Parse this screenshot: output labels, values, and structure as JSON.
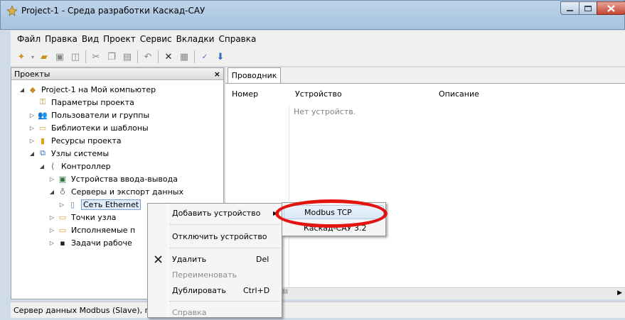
{
  "window": {
    "title": "Project-1 - Среда разработки Каскад-САУ"
  },
  "menu": [
    "Файл",
    "Правка",
    "Вид",
    "Проект",
    "Сервис",
    "Вкладки",
    "Справка"
  ],
  "projects_pane": {
    "title": "Проекты",
    "close_glyph": "×",
    "tree": [
      {
        "label": "Project-1 на Мой компьютер",
        "arrow": "◢",
        "icon": "◆",
        "color": "#c88c2a"
      },
      {
        "label": "Параметры проекта",
        "arrow": "",
        "icon": "⚿",
        "color": "#b08a1e"
      },
      {
        "label": "Пользователи и группы",
        "arrow": "▷",
        "icon": "👥",
        "color": "#4a6da0"
      },
      {
        "label": "Библиотеки и шаблоны",
        "arrow": "▷",
        "icon": "▭",
        "color": "#d9a53a"
      },
      {
        "label": "Ресурсы проекта",
        "arrow": "▷",
        "icon": "▮",
        "color": "#e0a020"
      },
      {
        "label": "Узлы системы",
        "arrow": "◢",
        "icon": "⧉",
        "color": "#3a6bbf"
      },
      {
        "label": "Контроллер",
        "arrow": "◢",
        "icon": "⟨",
        "color": "#555555"
      },
      {
        "label": "Устройства ввода-вывода",
        "arrow": "▷",
        "icon": "▣",
        "color": "#2f6f3a"
      },
      {
        "label": "Серверы и экспорт данных",
        "arrow": "◢",
        "icon": "♁",
        "color": "#777777"
      },
      {
        "label": "Сеть Ethernet",
        "arrow": "▷",
        "icon": "▯",
        "color": "#5a7db0"
      },
      {
        "label": "Точки узла",
        "arrow": "▷",
        "icon": "▭",
        "color": "#d9a53a"
      },
      {
        "label": "Исполняемые п",
        "arrow": "▷",
        "icon": "▭",
        "color": "#d9a53a"
      },
      {
        "label": "Задачи рабоче",
        "arrow": "▷",
        "icon": "▪",
        "color": "#222222"
      }
    ]
  },
  "explorer": {
    "tab": "Проводник",
    "columns": [
      "Номер",
      "Устройство",
      "Описание"
    ],
    "empty_text": "Нет устройств.",
    "hscroll_thumb": "III"
  },
  "context_menu": {
    "add_device": "Добавить устройство",
    "add_arrow": "▶",
    "disable_device": "Отключить устройство",
    "delete": "Удалить",
    "delete_shortcut": "Del",
    "rename": "Переименовать",
    "duplicate": "Дублировать",
    "duplicate_shortcut": "Ctrl+D",
    "help": "Справка"
  },
  "submenu": {
    "items": [
      "Modbus TCP",
      "Каскад-САУ 3.2"
    ]
  },
  "status": {
    "text": "Сервер данных Modbus (Slave), пр"
  },
  "colors": {
    "highlight_ring": "#e3140f",
    "selection": "#dfeafa"
  }
}
